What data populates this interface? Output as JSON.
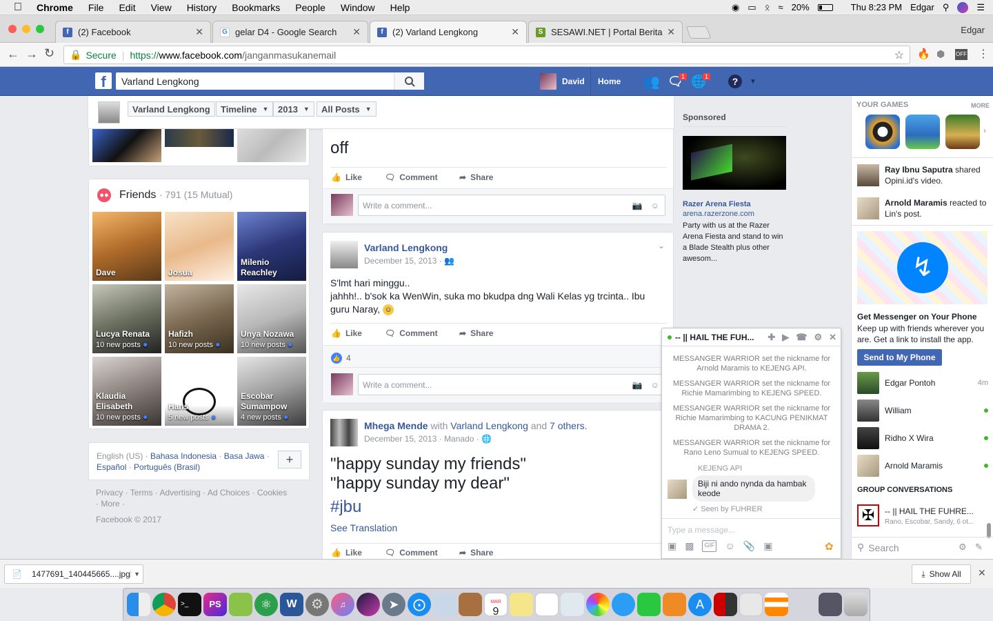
{
  "menubar": {
    "app": "Chrome",
    "items": [
      "File",
      "Edit",
      "View",
      "History",
      "Bookmarks",
      "People",
      "Window",
      "Help"
    ],
    "battery": "20%",
    "clock": "Thu 8:23 PM",
    "user": "Edgar"
  },
  "tabs": [
    {
      "title": "(2) Facebook",
      "icon": "facebook-icon"
    },
    {
      "title": "gelar D4 - Google Search",
      "icon": "google-icon"
    },
    {
      "title": "(2) Varland Lengkong",
      "icon": "facebook-icon"
    },
    {
      "title": "SESAWI.NET | Portal Berita Ka",
      "icon": "sesawi-icon"
    }
  ],
  "profile_name": "Edgar",
  "address": {
    "secure": "Secure",
    "scheme": "https://",
    "host": "www.facebook.com",
    "path": "/janganmasukanemail"
  },
  "fb": {
    "search_value": "Varland Lengkong",
    "user": "David",
    "home": "Home",
    "messages_badge": "1",
    "notifications_badge": "1"
  },
  "timeline_bar": {
    "name": "Varland Lengkong",
    "timeline": "Timeline",
    "year": "2013",
    "filter": "All Posts"
  },
  "friends": {
    "title": "Friends",
    "count": "791 (15 Mutual)",
    "items": [
      {
        "name": "Dave",
        "posts": ""
      },
      {
        "name": "Josua",
        "posts": ""
      },
      {
        "name": "Milenio Reachley",
        "posts": ""
      },
      {
        "name": "Lucya Renata",
        "posts": "10 new posts"
      },
      {
        "name": "Hafizh",
        "posts": "10 new posts"
      },
      {
        "name": "Unya Nozawa",
        "posts": "10 new posts"
      },
      {
        "name": "Klaudia Elisabeth",
        "posts": "10 new posts"
      },
      {
        "name": "Hans",
        "posts": "5 new posts"
      },
      {
        "name": "Escobar Sumampow",
        "posts": "4 new posts"
      }
    ]
  },
  "languages": {
    "current": "English (US) ·",
    "links": [
      "Bahasa Indonesia",
      "Basa Jawa",
      "Español",
      "Português (Brasil)"
    ]
  },
  "footer": {
    "links": "Privacy · Terms · Advertising · Ad Choices · Cookies",
    "more": "· More ·",
    "copyright": "Facebook © 2017"
  },
  "post1": {
    "text": "off"
  },
  "actions": {
    "like": "Like",
    "comment": "Comment",
    "share": "Share",
    "write_comment": "Write a comment..."
  },
  "post2": {
    "author": "Varland Lengkong",
    "date": "December 15, 2013 ·",
    "line1": "S'lmt hari minggu..",
    "line2": "jahhh!.. b'sok ka WenWin, suka mo bkudpa dng Wali Kelas yg trcinta.. Ibu",
    "line3": "guru Naray,",
    "likes": "4"
  },
  "post3": {
    "author": "Mhega Mende",
    "with": "with",
    "tagged": "Varland Lengkong",
    "and": "and",
    "others": "7 others.",
    "date": "December 15, 2013 · Manado ·",
    "line1": "\"happy sunday my friends\"",
    "line2": "\"happy sunday my dear\"",
    "hashtag": "#jbu",
    "translate": "See Translation"
  },
  "sponsored": {
    "label": "Sponsored",
    "title": "Razer Arena Fiesta",
    "domain": "arena.razerzone.com",
    "body": "Party with us at the Razer Arena Fiesta and stand to win a Blade Stealth plus other awesom..."
  },
  "chat": {
    "title": "-- || HAIL THE FUH...",
    "messages": [
      "MESSANGER WARRIOR set the nickname for Arnold Maramis to KEJENG API.",
      "MESSANGER WARRIOR set the nickname for Richie Mamarimbing to KEJENG SPEED.",
      "MESSANGER WARRIOR set the nickname for Richie Mamarimbing to KACUNG PENIKMAT DRAMA 2.",
      "MESSANGER WARRIOR set the nickname for Rano Leno Sumual to KEJENG SPEED."
    ],
    "sender": "KEJENG API",
    "bubble": "Biji ni ando nynda da hambak keode",
    "seen": "Seen by FUHRER",
    "placeholder": "Type a message..."
  },
  "right": {
    "games_title": "YOUR GAMES",
    "more": "MORE",
    "ticker1": {
      "name": "Ray Ibnu Saputra",
      "rest": "shared Opini.id's video."
    },
    "ticker2": {
      "name": "Arnold Maramis",
      "rest": "reacted to Lin's post."
    },
    "promo_title": "Get Messenger on Your Phone",
    "promo_body": "Keep up with friends wherever you are. Get a link to install the app.",
    "send_button": "Send to My Phone",
    "contacts": [
      {
        "name": "Edgar Pontoh",
        "meta": "4m"
      },
      {
        "name": "William",
        "meta": ""
      },
      {
        "name": "Ridho X Wira",
        "meta": ""
      },
      {
        "name": "Arnold Maramis",
        "meta": ""
      }
    ],
    "group_title": "GROUP CONVERSATIONS",
    "group_name": "-- || HAIL THE FUHRE...",
    "group_members": "Rano, Escobar, Sandy, 6 ot...",
    "search": "Search"
  },
  "download": {
    "file": "1477691_140445665....jpg",
    "show_all": "Show All"
  },
  "calendar": {
    "month": "MAR",
    "day": "9"
  }
}
